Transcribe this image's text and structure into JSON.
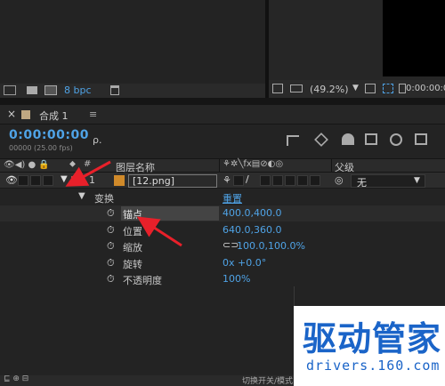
{
  "project_toolbar": {
    "bpc": "8 bpc"
  },
  "viewer_toolbar": {
    "zoom": "(49.2%)",
    "timecode": "0:00:00:0"
  },
  "comp_tab": {
    "title": "合成 1",
    "close": "≡"
  },
  "time": {
    "timecode": "0:00:00:00",
    "frames": "00000 (25.00 fps)",
    "search_placeholder": "ρ."
  },
  "header": {
    "layer_name": "图层名称",
    "parent": "父级"
  },
  "layer": {
    "index": "1",
    "name": "[12.png]",
    "parent_value": "无"
  },
  "transform": {
    "label": "变换",
    "reset": "重置",
    "props": [
      {
        "name": "锚点",
        "value": "400.0,400.0"
      },
      {
        "name": "位置",
        "value": "640.0,360.0"
      },
      {
        "name": "缩放",
        "value": "100.0,100.0%"
      },
      {
        "name": "旋转",
        "value": "0x +0.0°"
      },
      {
        "name": "不透明度",
        "value": "100%"
      }
    ]
  },
  "status": {
    "toggle": "切换开关/模式"
  },
  "watermark": {
    "brand": "驱动管家",
    "url": "drivers.160.com"
  },
  "colors": {
    "accent": "#4fa3e6",
    "annotation": "#e8202a",
    "layer_label": "#c84a4a"
  }
}
